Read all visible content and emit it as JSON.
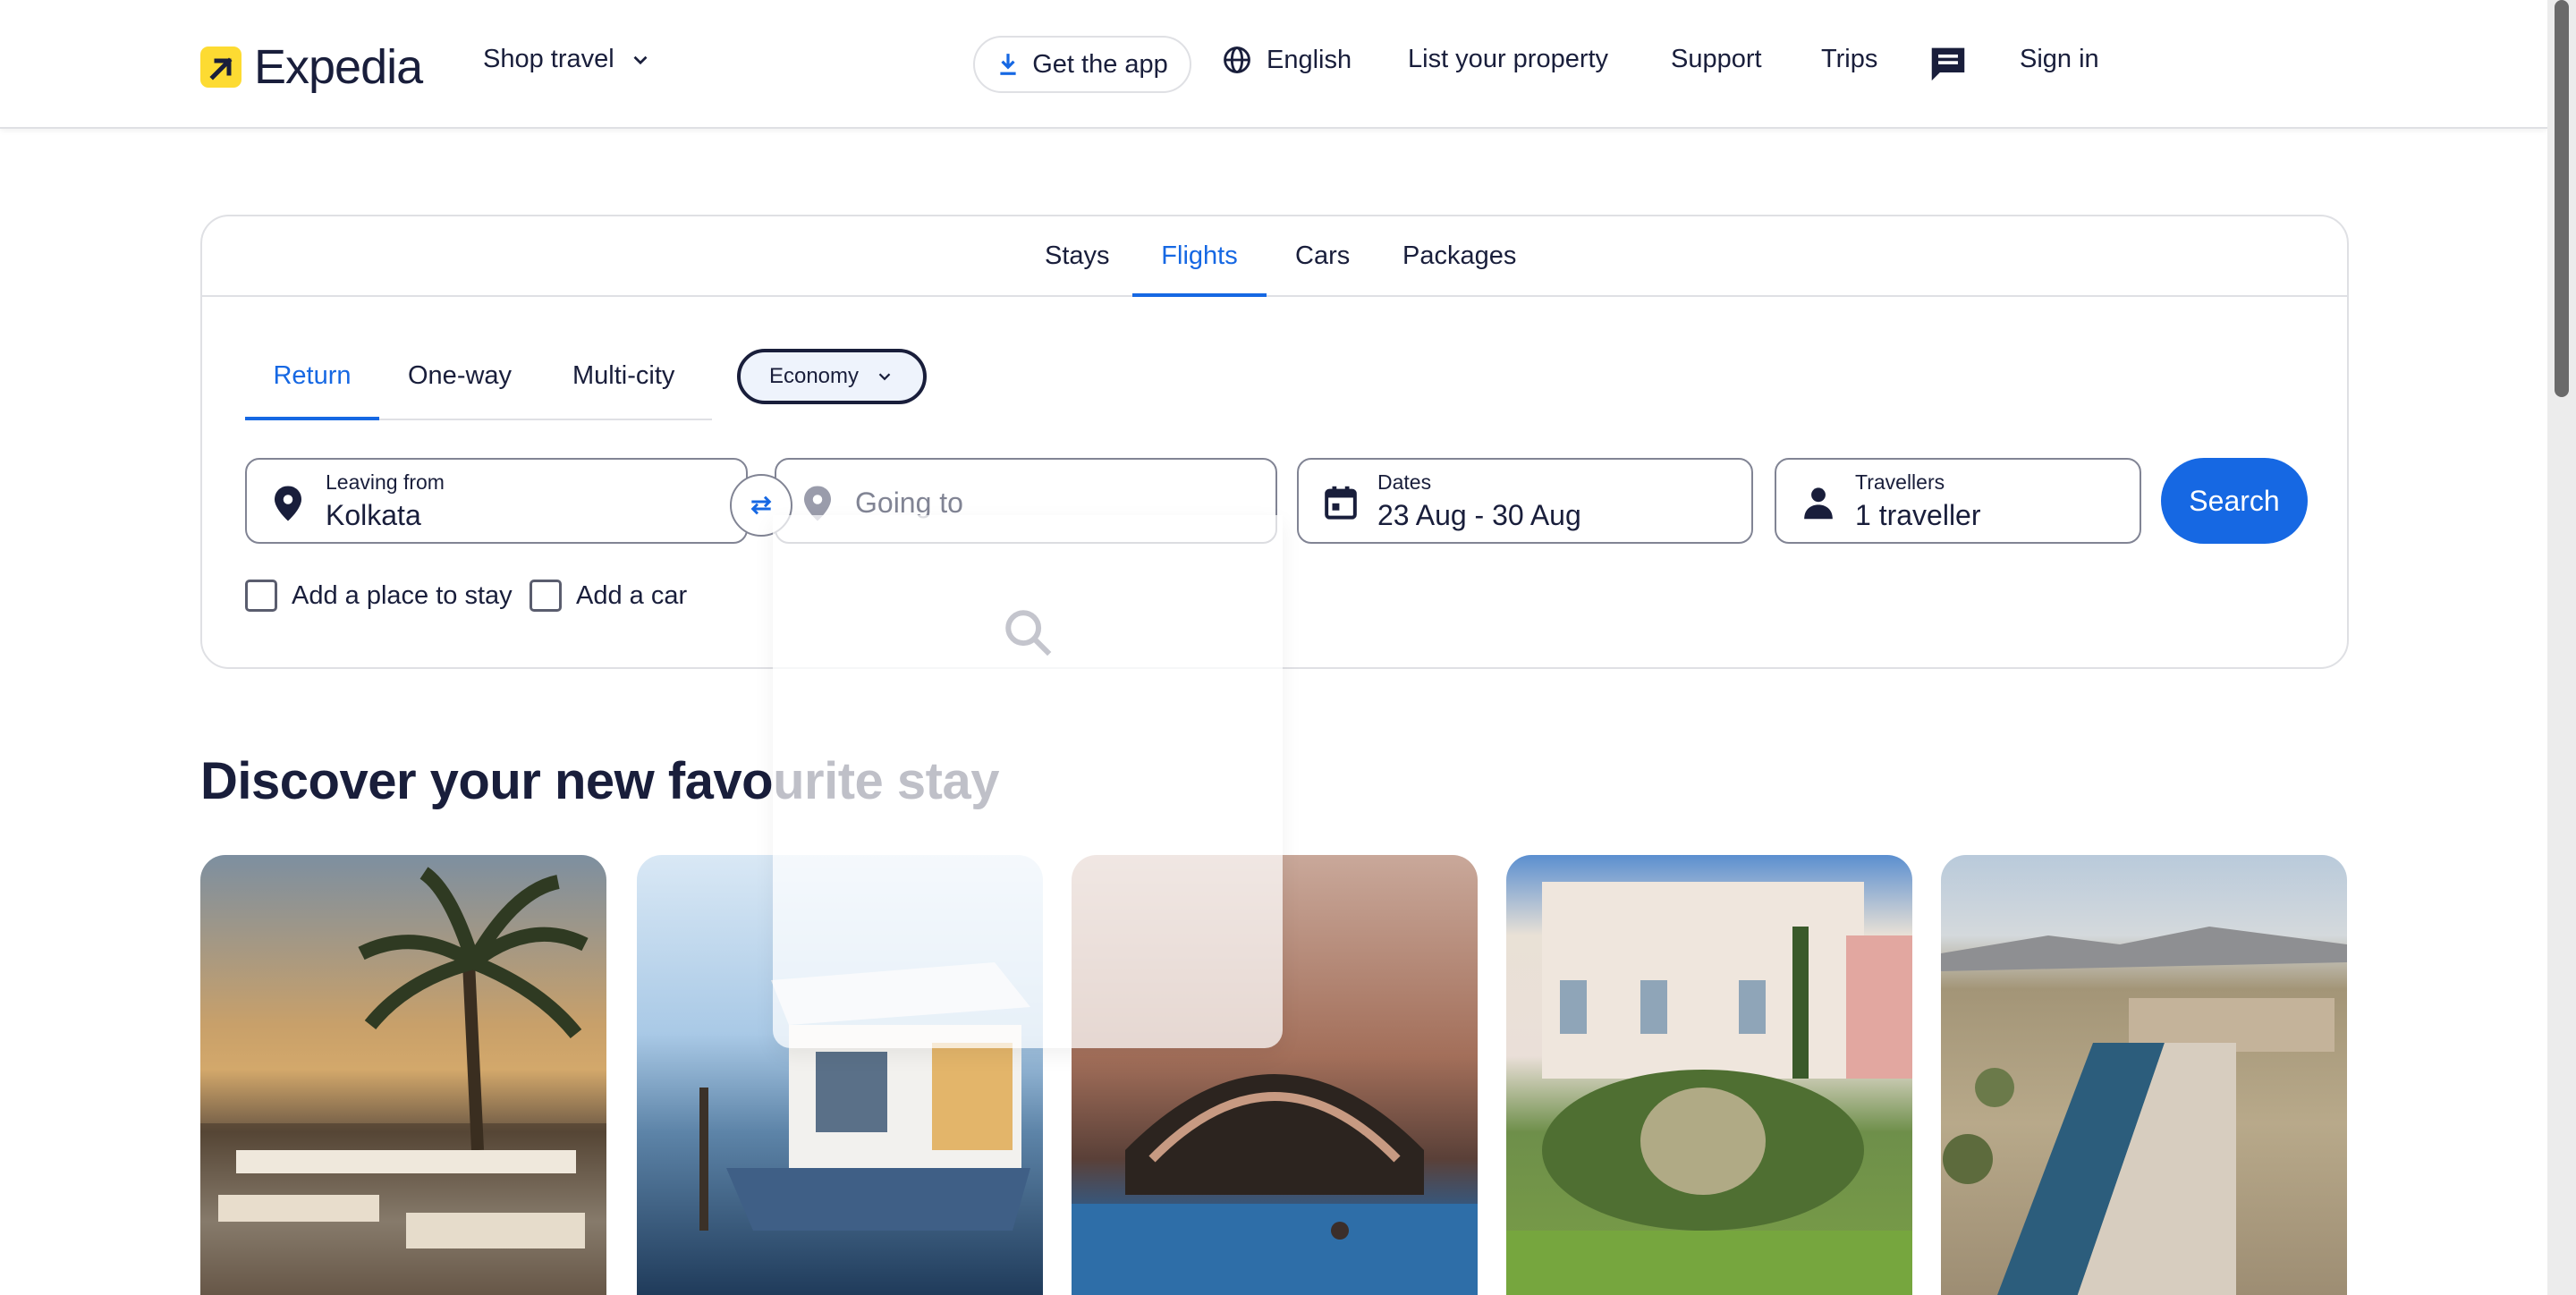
{
  "header": {
    "logo_text": "Expedia",
    "shop_travel": "Shop travel",
    "get_app": "Get the app",
    "language": "English",
    "list_property": "List your property",
    "support": "Support",
    "trips": "Trips",
    "sign_in": "Sign in"
  },
  "search": {
    "tabs": [
      "Stays",
      "Flights",
      "Cars",
      "Packages"
    ],
    "active_tab": "Flights",
    "trip_types": [
      "Return",
      "One-way",
      "Multi-city"
    ],
    "active_trip_type": "Return",
    "cabin_class": "Economy",
    "leaving_from": {
      "label": "Leaving from",
      "value": "Kolkata"
    },
    "going_to": {
      "placeholder": "Going to"
    },
    "dates": {
      "label": "Dates",
      "value": "23 Aug - 30 Aug"
    },
    "travellers": {
      "label": "Travellers",
      "value": "1 traveller"
    },
    "search_button": "Search",
    "add_stay": "Add a place to stay",
    "add_car": "Add a car"
  },
  "discover": {
    "title": "Discover your new favourite stay"
  },
  "colors": {
    "brand_yellow": "#fddb32",
    "primary_blue": "#1668e3",
    "navy": "#191e3b"
  }
}
